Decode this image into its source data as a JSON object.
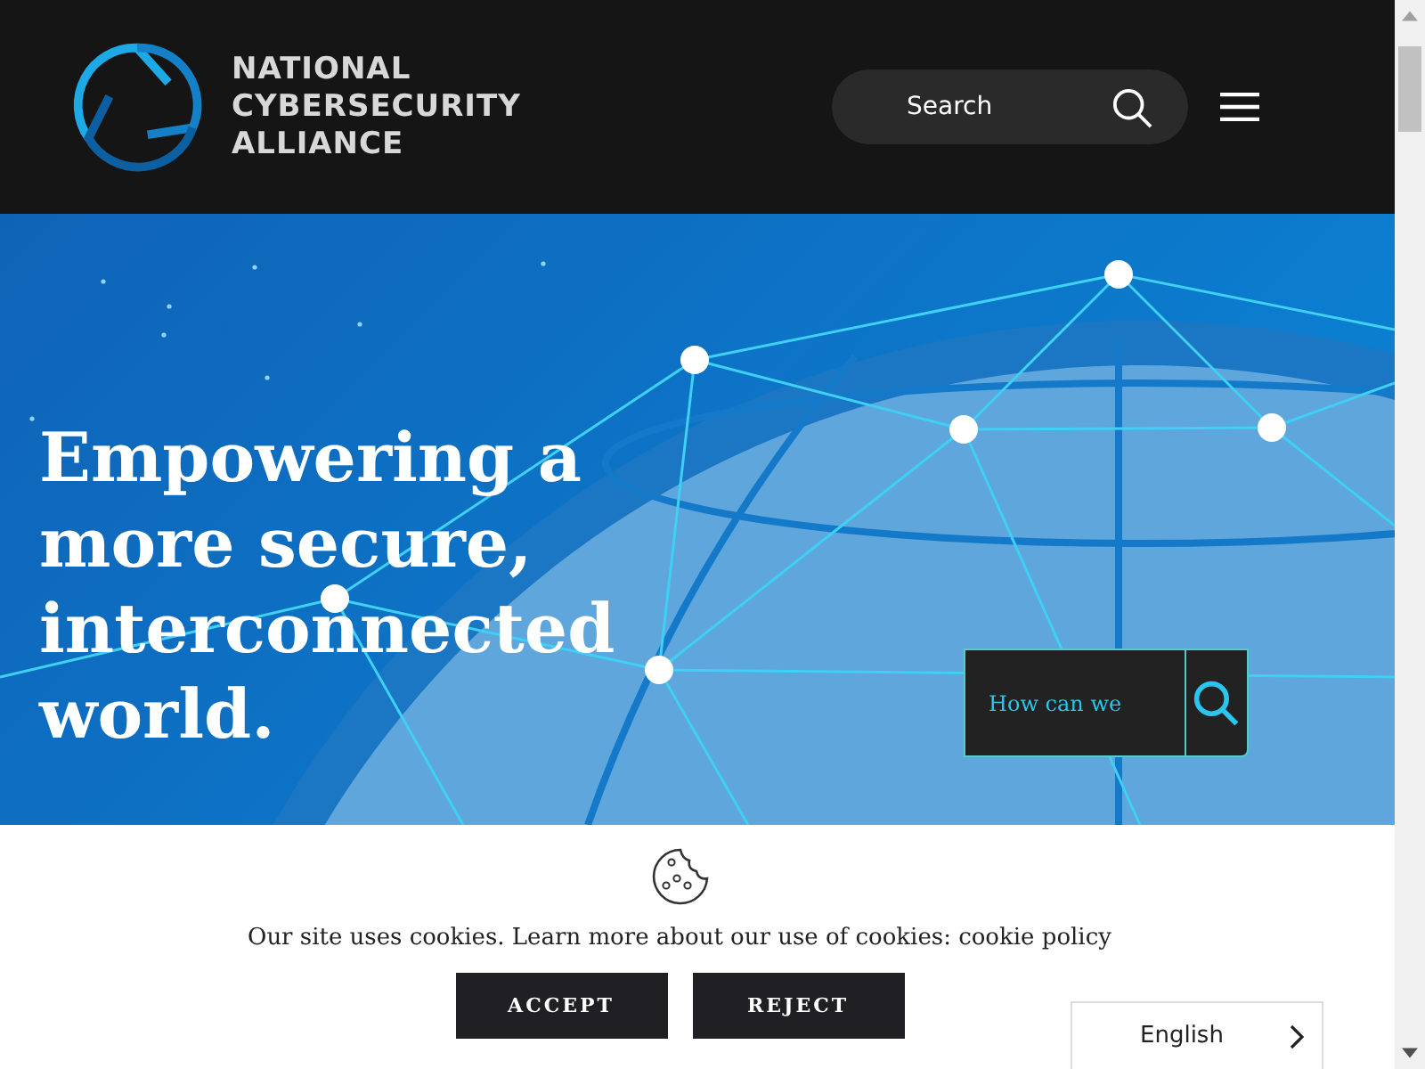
{
  "header": {
    "logo_lines": [
      "NATIONAL",
      "CYBERSECURITY",
      "ALLIANCE"
    ],
    "search": {
      "placeholder": "Search"
    }
  },
  "hero": {
    "heading": "Empowering a more secure, interconnected world.",
    "search": {
      "placeholder": "How can we"
    }
  },
  "cookie_banner": {
    "message": "Our site uses cookies. Learn more about our use of cookies: ",
    "link": "cookie policy",
    "buttons": [
      "ACCEPT",
      "REJECT"
    ]
  },
  "language_selector": {
    "label": "English"
  }
}
